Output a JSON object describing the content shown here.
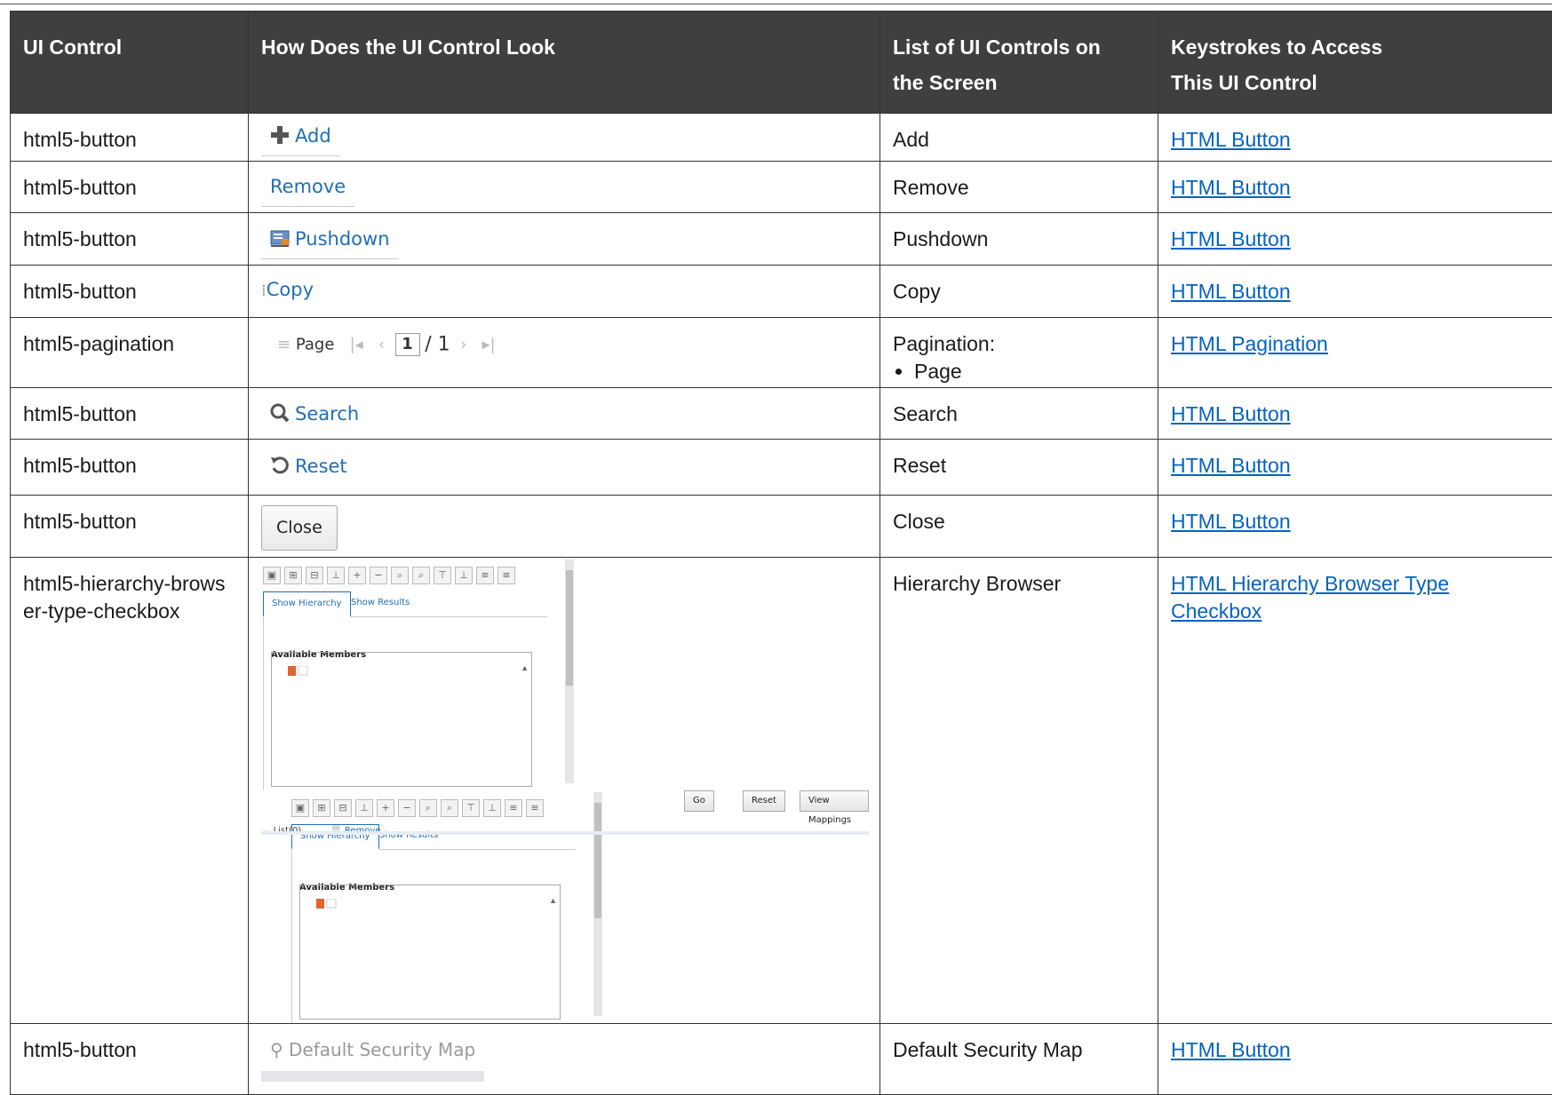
{
  "headers": {
    "ui_control": "UI Control",
    "look": "How Does the UI Control Look",
    "list": "List of UI Controls on the Screen",
    "keys": "Keystrokes to Access This UI Control"
  },
  "rows": [
    {
      "control": "html5-button",
      "look": "Add",
      "list": "Add",
      "link": "HTML Button"
    },
    {
      "control": "html5-button",
      "look": "Remove",
      "list": "Remove",
      "link": "HTML Button"
    },
    {
      "control": "html5-button",
      "look": "Pushdown",
      "list": "Pushdown",
      "link": "HTML Button"
    },
    {
      "control": "html5-button",
      "look": "Copy",
      "list": "Copy",
      "link": "HTML Button"
    },
    {
      "control": "html5-pagination",
      "look_page": "Page",
      "look_current": "1",
      "look_total": "/ 1",
      "list": "Pagination:",
      "list_bullet": "Page",
      "link": "HTML Pagination"
    },
    {
      "control": "html5-button",
      "look": "Search",
      "list": "Search",
      "link": "HTML Button"
    },
    {
      "control": "html5-button",
      "look": "Reset",
      "list": "Reset",
      "link": "HTML Button"
    },
    {
      "control": "html5-button",
      "look": "Close",
      "list": "Close",
      "link": "HTML Button"
    },
    {
      "control": "html5-hierarchy-browser-type-checkbox",
      "list": "Hierarchy Browser",
      "link": "HTML Hierarchy Browser Type Checkbox"
    },
    {
      "control": "html5-button",
      "look": "Default Security Map",
      "list": "Default Security Map",
      "link": "HTML Button"
    }
  ],
  "hierarchy_browser": {
    "tab_show_hierarchy": "Show Hierarchy",
    "tab_show_results": "Show Results",
    "available_members": "Available Members",
    "go": "Go",
    "reset": "Reset",
    "view_mappings": "View Mappings",
    "list_label": "List(0)",
    "remove": "Remove"
  },
  "colors": {
    "header_bg": "#3f3f3f",
    "link": "#0563c1",
    "ui_blue": "#1f6fb5"
  }
}
